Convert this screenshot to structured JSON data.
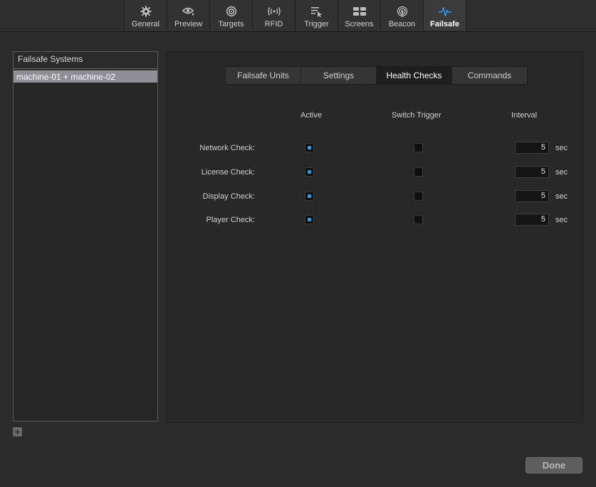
{
  "toolbar": {
    "items": [
      {
        "label": "General",
        "icon": "gear-icon"
      },
      {
        "label": "Preview",
        "icon": "eye-icon"
      },
      {
        "label": "Targets",
        "icon": "target-icon"
      },
      {
        "label": "RFID",
        "icon": "rfid-icon"
      },
      {
        "label": "Trigger",
        "icon": "trigger-icon"
      },
      {
        "label": "Screens",
        "icon": "screens-icon"
      },
      {
        "label": "Beacon",
        "icon": "beacon-icon"
      },
      {
        "label": "Failsafe",
        "icon": "pulse-icon"
      }
    ],
    "active": "Failsafe",
    "accent_color": "#2f9bf0"
  },
  "systems": {
    "header": "Failsafe Systems",
    "items": [
      "machine-01 + machine-02"
    ],
    "add_icon": "plus-icon"
  },
  "tabs": {
    "items": [
      "Failsafe Units",
      "Settings",
      "Health Checks",
      "Commands"
    ],
    "active": "Health Checks"
  },
  "health": {
    "columns": {
      "active": "Active",
      "switch_trigger": "Switch Trigger",
      "interval": "Interval"
    },
    "rows": [
      {
        "label": "Network Check:",
        "active": true,
        "switch_trigger": false,
        "interval": "5",
        "unit": "sec"
      },
      {
        "label": "License Check:",
        "active": true,
        "switch_trigger": false,
        "interval": "5",
        "unit": "sec"
      },
      {
        "label": "Display Check:",
        "active": true,
        "switch_trigger": false,
        "interval": "5",
        "unit": "sec"
      },
      {
        "label": "Player Check:",
        "active": true,
        "switch_trigger": false,
        "interval": "5",
        "unit": "sec"
      }
    ]
  },
  "footer": {
    "done_label": "Done"
  }
}
